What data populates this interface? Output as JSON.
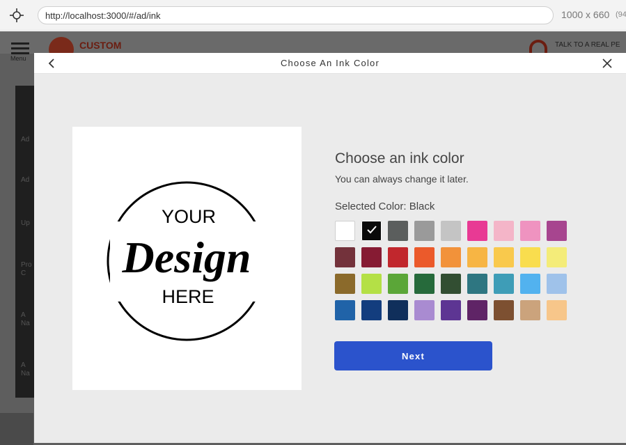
{
  "browser": {
    "url": "http://localhost:3000/#/ad/ink",
    "viewport_size": "1000 x 660",
    "viewport_extra": "(94"
  },
  "background_page": {
    "menu_label": "Menu",
    "logo_text": "CUSTOM",
    "talk_text": "TALK TO A REAL PE",
    "sidebar_partial_labels": [
      "Ad",
      "Ad",
      "Up",
      "Pro",
      "C",
      "A",
      "Na",
      "A",
      "Na"
    ]
  },
  "modal": {
    "title": "Choose An Ink Color",
    "back_icon": "chevron-left-icon",
    "close_icon": "close-icon",
    "preview": {
      "line1": "YOUR",
      "line2": "Design",
      "line3": "HERE"
    },
    "heading": "Choose an ink color",
    "subheading": "You can always change it later.",
    "selected_color_label": "Selected Color: Black",
    "selected_index": 1,
    "next_label": "Next",
    "swatches": [
      {
        "color": "#ffffff"
      },
      {
        "color": "#0a0a0a"
      },
      {
        "color": "#5b5e5d"
      },
      {
        "color": "#9a9a9a"
      },
      {
        "color": "#c4c4c4"
      },
      {
        "color": "#e83a94"
      },
      {
        "color": "#f4b5c8"
      },
      {
        "color": "#ef93c0"
      },
      {
        "color": "#a7458f"
      },
      {
        "color": "#73323b"
      },
      {
        "color": "#861b33"
      },
      {
        "color": "#c1272d"
      },
      {
        "color": "#eb5a2b"
      },
      {
        "color": "#f2923a"
      },
      {
        "color": "#f7b544"
      },
      {
        "color": "#f9c94c"
      },
      {
        "color": "#f9dd4e"
      },
      {
        "color": "#f4ec79"
      },
      {
        "color": "#8b6a2b"
      },
      {
        "color": "#b4e046"
      },
      {
        "color": "#5ba638"
      },
      {
        "color": "#266a3b"
      },
      {
        "color": "#324e32"
      },
      {
        "color": "#2e7681"
      },
      {
        "color": "#3e9db7"
      },
      {
        "color": "#52b2ef"
      },
      {
        "color": "#9fc2ea"
      },
      {
        "color": "#2063a8"
      },
      {
        "color": "#133d7e"
      },
      {
        "color": "#102f5b"
      },
      {
        "color": "#a98bd1"
      },
      {
        "color": "#5d3593"
      },
      {
        "color": "#5f2466"
      },
      {
        "color": "#7d5031"
      },
      {
        "color": "#cba37c"
      },
      {
        "color": "#f7c68a"
      }
    ]
  }
}
